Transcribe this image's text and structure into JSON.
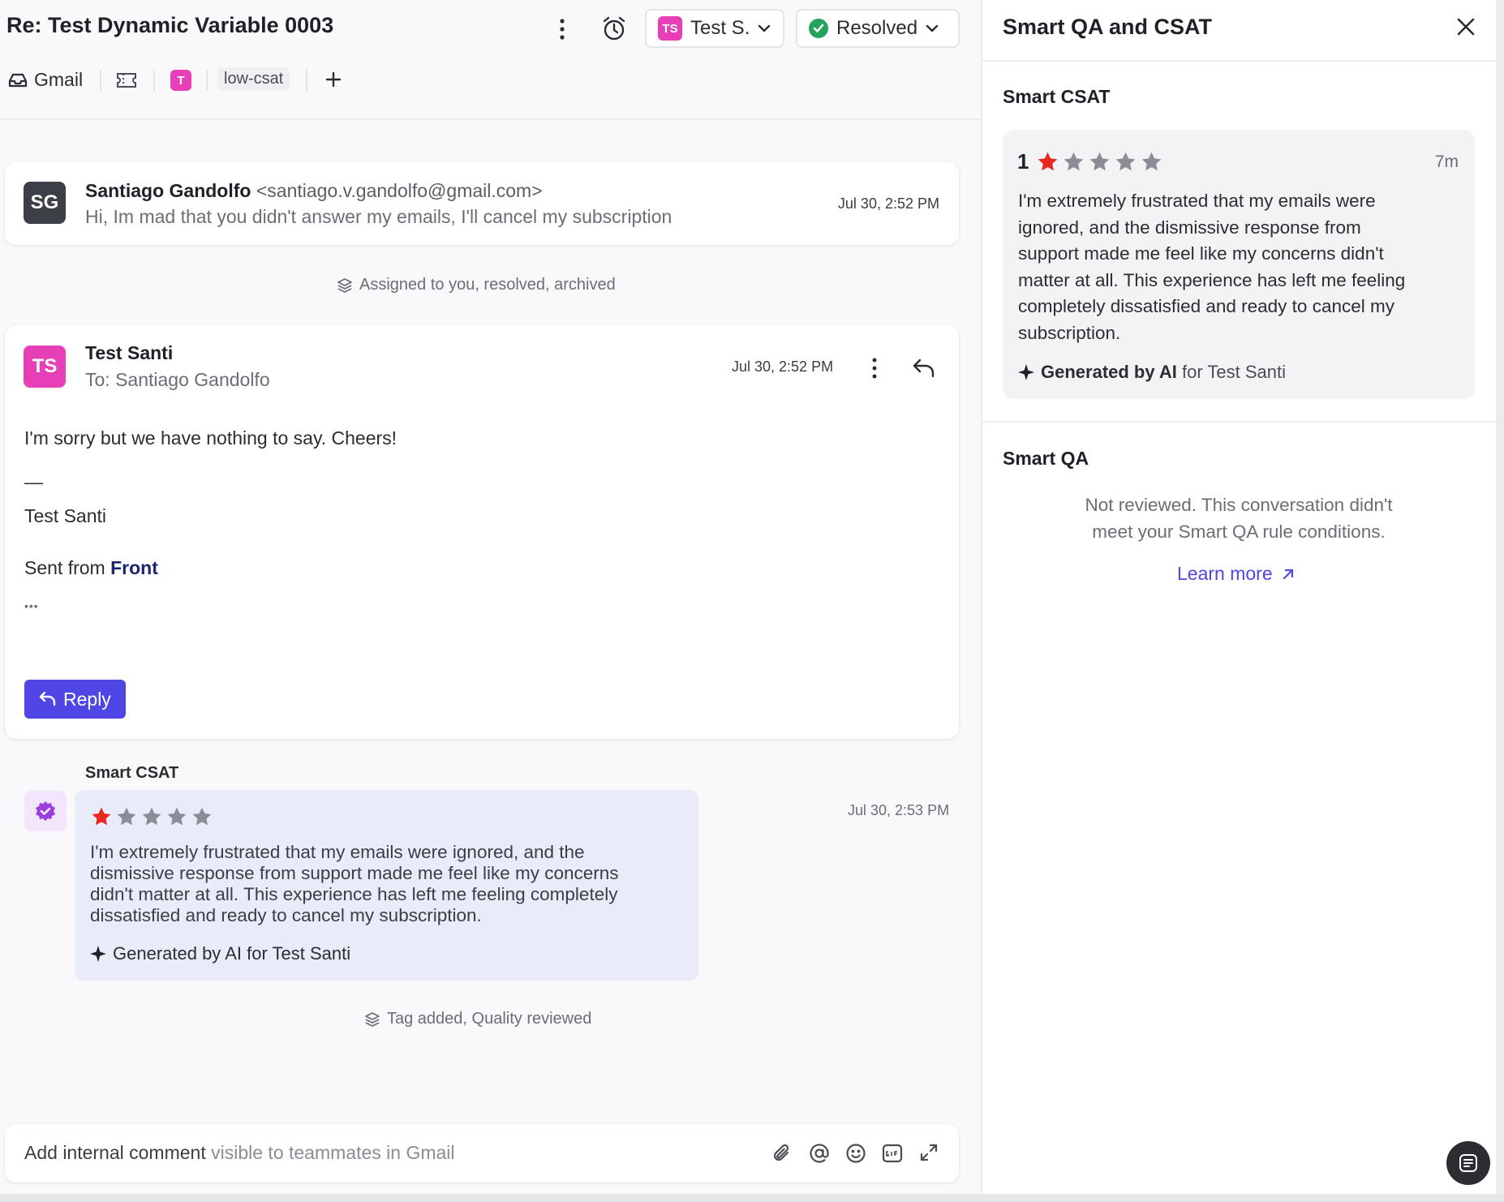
{
  "conversation": {
    "title": "Re: Test Dynamic Variable 0003",
    "assignee": {
      "initials": "TS",
      "label": "Test S."
    },
    "status_label": "Resolved"
  },
  "toolbar": {
    "inbox_label": "Gmail",
    "tag_badge": "T",
    "tag_chip": "low-csat"
  },
  "messages": [
    {
      "initials": "SG",
      "sender": "Santiago Gandolfo",
      "email": "<santiago.v.gandolfo@gmail.com>",
      "preview": "Hi, Im mad that you didn't answer my emails, I'll cancel my subscription",
      "time": "Jul 30, 2:52 PM"
    },
    {
      "initials": "TS",
      "sender": "Test Santi",
      "to": "To: Santiago Gandolfo",
      "time": "Jul 30, 2:52 PM",
      "body": "I'm sorry but we have nothing to say. Cheers!",
      "sig_dash": "—",
      "sig_name": "Test Santi",
      "sent_from_prefix": "Sent from ",
      "sent_from_app": "Front",
      "ellipsis": "•••",
      "reply_label": "Reply"
    }
  ],
  "events": [
    "Assigned to you, resolved, archived",
    "Tag added, Quality reviewed"
  ],
  "csat_activity": {
    "label": "Smart CSAT",
    "rating": 1,
    "max_rating": 5,
    "time": "Jul 30, 2:53 PM",
    "lines": [
      "I'm extremely frustrated that my emails were ignored, and the",
      "dismissive response from support made me feel like my concerns",
      "didn't matter at all. This experience has left me feeling completely",
      "dissatisfied and ready to cancel my subscription."
    ],
    "ai_label": "Generated by AI for Test Santi"
  },
  "comment": {
    "prefix": "Add internal comment",
    "suffix": " visible to teammates in Gmail"
  },
  "panel": {
    "title": "Smart QA and CSAT",
    "csat": {
      "heading": "Smart CSAT",
      "score": "1",
      "rating": 1,
      "max_rating": 5,
      "age": "7m",
      "lines": [
        "I'm extremely frustrated that my emails were",
        "ignored, and the dismissive response from",
        "support made me feel like my concerns didn't",
        "matter at all. This experience has left me feeling",
        "completely dissatisfied and ready to cancel my",
        "subscription."
      ],
      "ai_bold": "Generated by AI",
      "ai_rest": " for Test Santi"
    },
    "qa": {
      "heading": "Smart QA",
      "lines": [
        "Not reviewed. This conversation didn't",
        "meet your Smart QA rule conditions."
      ],
      "learn_more": "Learn more"
    }
  },
  "colors": {
    "accent": "#4f46e5",
    "star_filled": "#e8281e",
    "star_empty": "#8a8c96",
    "avatar_pink": "#e63fb8",
    "avatar_dark": "#3d3f47",
    "resolved_green": "#22a45d"
  }
}
